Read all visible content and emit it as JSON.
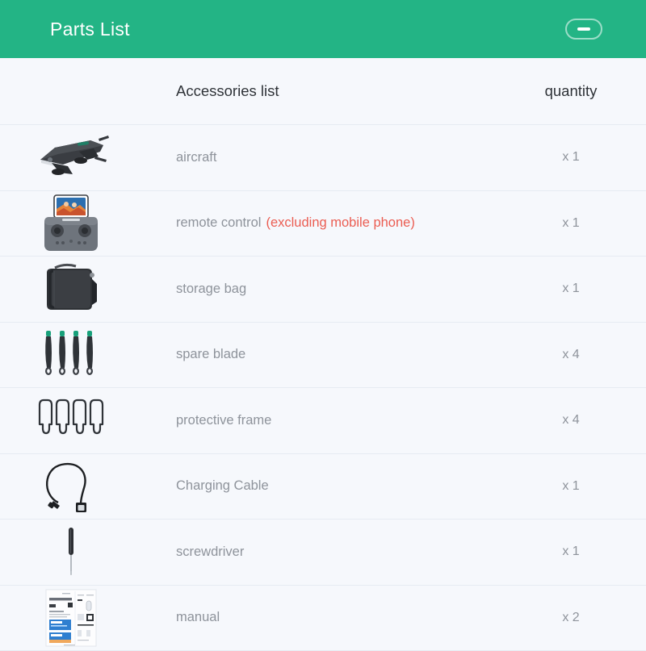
{
  "header": {
    "title": "Parts List",
    "background_color": "#23b485",
    "title_color": "#ffffff",
    "collapse_button_icon": "minus-icon"
  },
  "table": {
    "columns": {
      "image": "",
      "name": "Accessories list",
      "quantity": "quantity"
    },
    "rows": [
      {
        "image": "drone-folded-image",
        "name": "aircraft",
        "note": "",
        "quantity": "x 1"
      },
      {
        "image": "remote-control-image",
        "name": "remote control",
        "note": "(excluding mobile phone)",
        "quantity": "x 1"
      },
      {
        "image": "storage-bag-image",
        "name": "storage bag",
        "note": "",
        "quantity": "x 1"
      },
      {
        "image": "spare-blade-image",
        "name": "spare blade",
        "note": "",
        "quantity": "x 4"
      },
      {
        "image": "protective-frame-image",
        "name": "protective frame",
        "note": "",
        "quantity": "x 4"
      },
      {
        "image": "charging-cable-image",
        "name": "Charging Cable",
        "note": "",
        "quantity": "x 1"
      },
      {
        "image": "screwdriver-image",
        "name": "screwdriver",
        "note": "",
        "quantity": "x 1"
      },
      {
        "image": "manual-image",
        "name": "manual",
        "note": "",
        "quantity": "x 2"
      }
    ]
  },
  "colors": {
    "accent_green": "#23b485",
    "page_background": "#f6f8fc",
    "divider": "#e6ebf2",
    "body_text": "#8e939b",
    "heading_text": "#2f3338",
    "note_red": "#eb5d52"
  }
}
